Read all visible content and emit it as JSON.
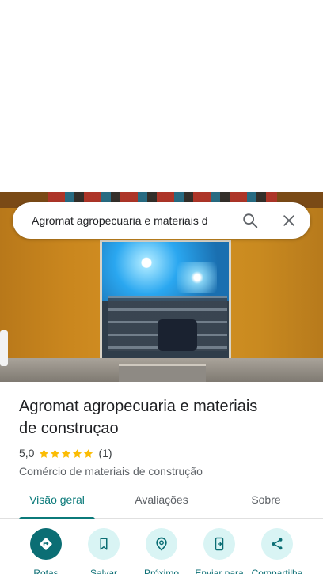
{
  "search": {
    "query": "Agromat agropecuaria e materiais d"
  },
  "place": {
    "title_line1": "Agromat agropecuaria e materiais",
    "title_line2": "de construçao",
    "rating": "5,0",
    "stars": 5,
    "review_count": "(1)",
    "category": "Comércio de materiais de construção"
  },
  "tabs": [
    {
      "label": "Visão geral",
      "active": true
    },
    {
      "label": "Avaliações",
      "active": false
    },
    {
      "label": "Sobre",
      "active": false
    }
  ],
  "actions": [
    {
      "label": "Rotas",
      "icon": "directions-icon"
    },
    {
      "label": "Salvar",
      "icon": "bookmark-icon"
    },
    {
      "label": "Próximo",
      "icon": "nearby-icon"
    },
    {
      "label": "Enviar para",
      "icon": "send-to-phone-icon"
    },
    {
      "label": "Compartilha",
      "icon": "share-icon"
    }
  ],
  "colors": {
    "accent": "#0b6e74",
    "tab_active": "#0b7a7a",
    "action_bg": "#d9f4f4",
    "star": "#fbbc04"
  }
}
